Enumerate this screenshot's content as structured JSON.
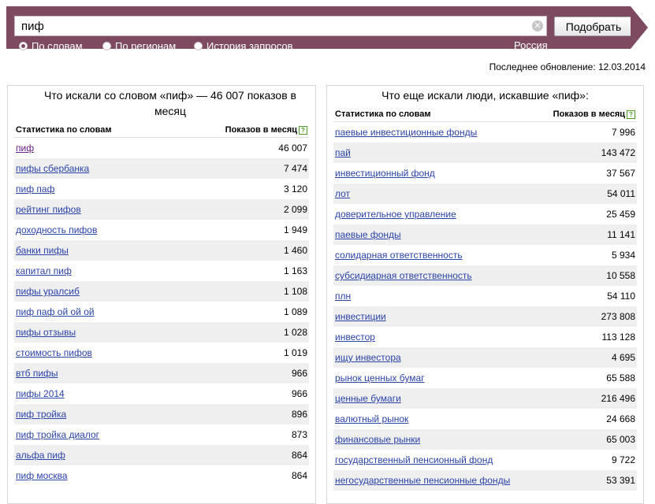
{
  "search": {
    "query": "пиф",
    "submit_label": "Подобрать",
    "options": [
      {
        "label": "По словам",
        "checked": true
      },
      {
        "label": "По регионам",
        "checked": false
      },
      {
        "label": "История запросов",
        "checked": false
      }
    ],
    "region": "Россия"
  },
  "last_update": "Последнее обновление: 12.03.2014",
  "left": {
    "title": "Что искали со словом «пиф» — 46 007 показов в месяц",
    "col_keyword": "Статистика по словам",
    "col_count": "Показов в месяц",
    "help": "?",
    "rows": [
      {
        "kw": "пиф",
        "count": "46 007"
      },
      {
        "kw": "пифы сбербанка",
        "count": "7 474"
      },
      {
        "kw": "пиф паф",
        "count": "3 120"
      },
      {
        "kw": "рейтинг пифов",
        "count": "2 099"
      },
      {
        "kw": "доходность пифов",
        "count": "1 949"
      },
      {
        "kw": "банки пифы",
        "count": "1 460"
      },
      {
        "kw": "капитал пиф",
        "count": "1 163"
      },
      {
        "kw": "пифы уралсиб",
        "count": "1 108"
      },
      {
        "kw": "пиф паф ой ой ой",
        "count": "1 089"
      },
      {
        "kw": "пифы отзывы",
        "count": "1 028"
      },
      {
        "kw": "стоимость пифов",
        "count": "1 019"
      },
      {
        "kw": "втб пифы",
        "count": "966"
      },
      {
        "kw": "пифы 2014",
        "count": "966"
      },
      {
        "kw": "пиф тройка",
        "count": "896"
      },
      {
        "kw": "пиф тройка диалог",
        "count": "873"
      },
      {
        "kw": "альфа пиф",
        "count": "864"
      },
      {
        "kw": "пиф москва",
        "count": "864"
      }
    ]
  },
  "right": {
    "title": "Что еще искали люди, искавшие «пиф»:",
    "col_keyword": "Статистика по словам",
    "col_count": "Показов в месяц",
    "help": "?",
    "rows": [
      {
        "kw": "паевые инвестиционные фонды",
        "count": "7 996"
      },
      {
        "kw": "пай",
        "count": "143 472"
      },
      {
        "kw": "инвестиционный фонд",
        "count": "37 567"
      },
      {
        "kw": "лот",
        "count": "54 011"
      },
      {
        "kw": "доверительное управление",
        "count": "25 459"
      },
      {
        "kw": "паевые фонды",
        "count": "11 141"
      },
      {
        "kw": "солидарная ответственность",
        "count": "5 934"
      },
      {
        "kw": "субсидиарная ответственность",
        "count": "10 558"
      },
      {
        "kw": "плн",
        "count": "54 110"
      },
      {
        "kw": "инвестиции",
        "count": "273 808"
      },
      {
        "kw": "инвестор",
        "count": "113 128"
      },
      {
        "kw": "ищу инвестора",
        "count": "4 695"
      },
      {
        "kw": "рынок ценных бумаг",
        "count": "65 588"
      },
      {
        "kw": "ценные бумаги",
        "count": "216 496"
      },
      {
        "kw": "валютный рынок",
        "count": "24 668"
      },
      {
        "kw": "финансовые рынки",
        "count": "65 003"
      },
      {
        "kw": "государственный пенсионный фонд",
        "count": "9 722"
      },
      {
        "kw": "негосударственные пенсионные фонды",
        "count": "53 391"
      }
    ]
  }
}
